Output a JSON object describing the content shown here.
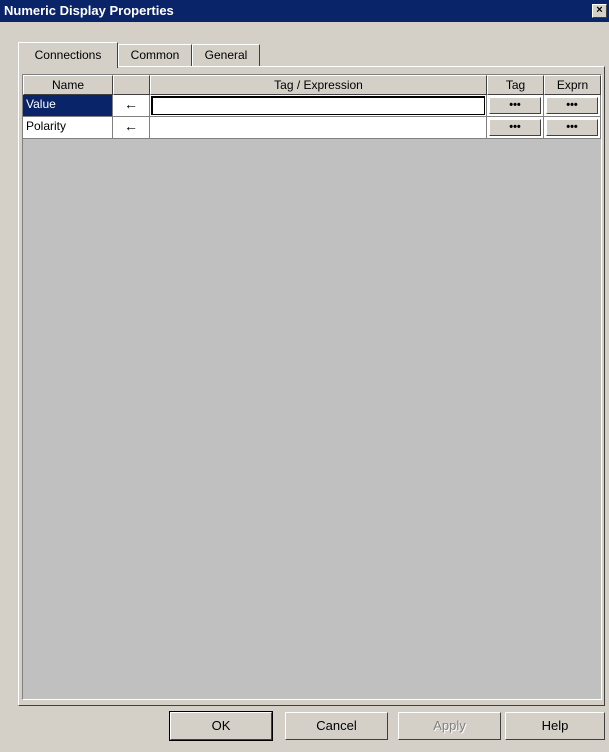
{
  "window": {
    "title": "Numeric Display Properties",
    "close_glyph": "×"
  },
  "tabs": [
    {
      "label": "Connections",
      "active": true
    },
    {
      "label": "Common",
      "active": false
    },
    {
      "label": "General",
      "active": false
    }
  ],
  "grid": {
    "headers": {
      "name": "Name",
      "dir": "",
      "expression": "Tag / Expression",
      "tag": "Tag",
      "exprn": "Exprn"
    },
    "rows": [
      {
        "name": "Value",
        "direction_glyph": "←",
        "expression": "",
        "tag_btn": "•••",
        "exprn_btn": "•••",
        "selected": true
      },
      {
        "name": "Polarity",
        "direction_glyph": "←",
        "expression": "",
        "tag_btn": "•••",
        "exprn_btn": "•••",
        "selected": false
      }
    ]
  },
  "buttons": {
    "ok": "OK",
    "cancel": "Cancel",
    "apply": "Apply",
    "help": "Help"
  }
}
